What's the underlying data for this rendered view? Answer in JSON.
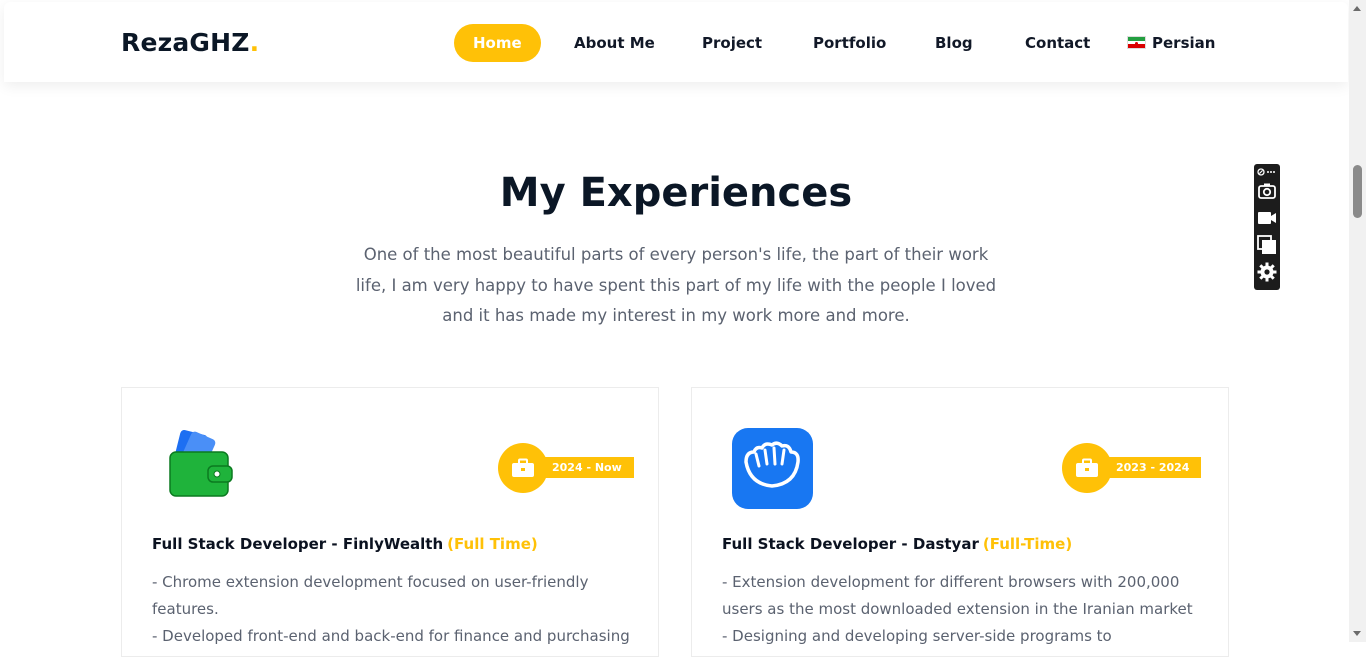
{
  "nav": {
    "brand": "RezaGHZ",
    "brand_dot": ".",
    "links": [
      "Home",
      "About Me",
      "Project",
      "Portfolio",
      "Blog",
      "Contact"
    ],
    "active": "Home",
    "language": "Persian",
    "language_flag": "iran-flag-icon"
  },
  "section": {
    "title": "My Experiences",
    "description_lines": [
      "One of the most beautiful parts of every person's life, the part of their work",
      "life, I am very happy to have spent this part of my life with the people I loved",
      "and it has made my interest in my work more and more."
    ]
  },
  "experiences": [
    {
      "logo": "wallet-icon",
      "period": "2024 - Now",
      "title": "Full Stack Developer - FinlyWealth",
      "type": "(Full Time)",
      "lines": [
        "- Chrome extension development focused on user-friendly",
        "features.",
        "- Developed front-end and back-end for finance and purchasing"
      ]
    },
    {
      "logo": "dastyar-hand-icon",
      "period": "2023 - 2024",
      "title": "Full Stack Developer - Dastyar",
      "type": "(Full-Time)",
      "lines": [
        "- Extension development for different browsers with 200,000",
        "users as the most downloaded extension in the Iranian market",
        "- Designing and developing server-side programs to"
      ]
    }
  ],
  "colors": {
    "accent": "#ffc107",
    "heading": "#0b1726",
    "body_text": "#5b6270",
    "dastyar_blue": "#1877f2",
    "wallet_green": "#1fb33b"
  },
  "toolbar_icons": [
    "extension-icon",
    "more-icon",
    "camera-icon",
    "video-icon",
    "window-icon",
    "gear-icon"
  ]
}
